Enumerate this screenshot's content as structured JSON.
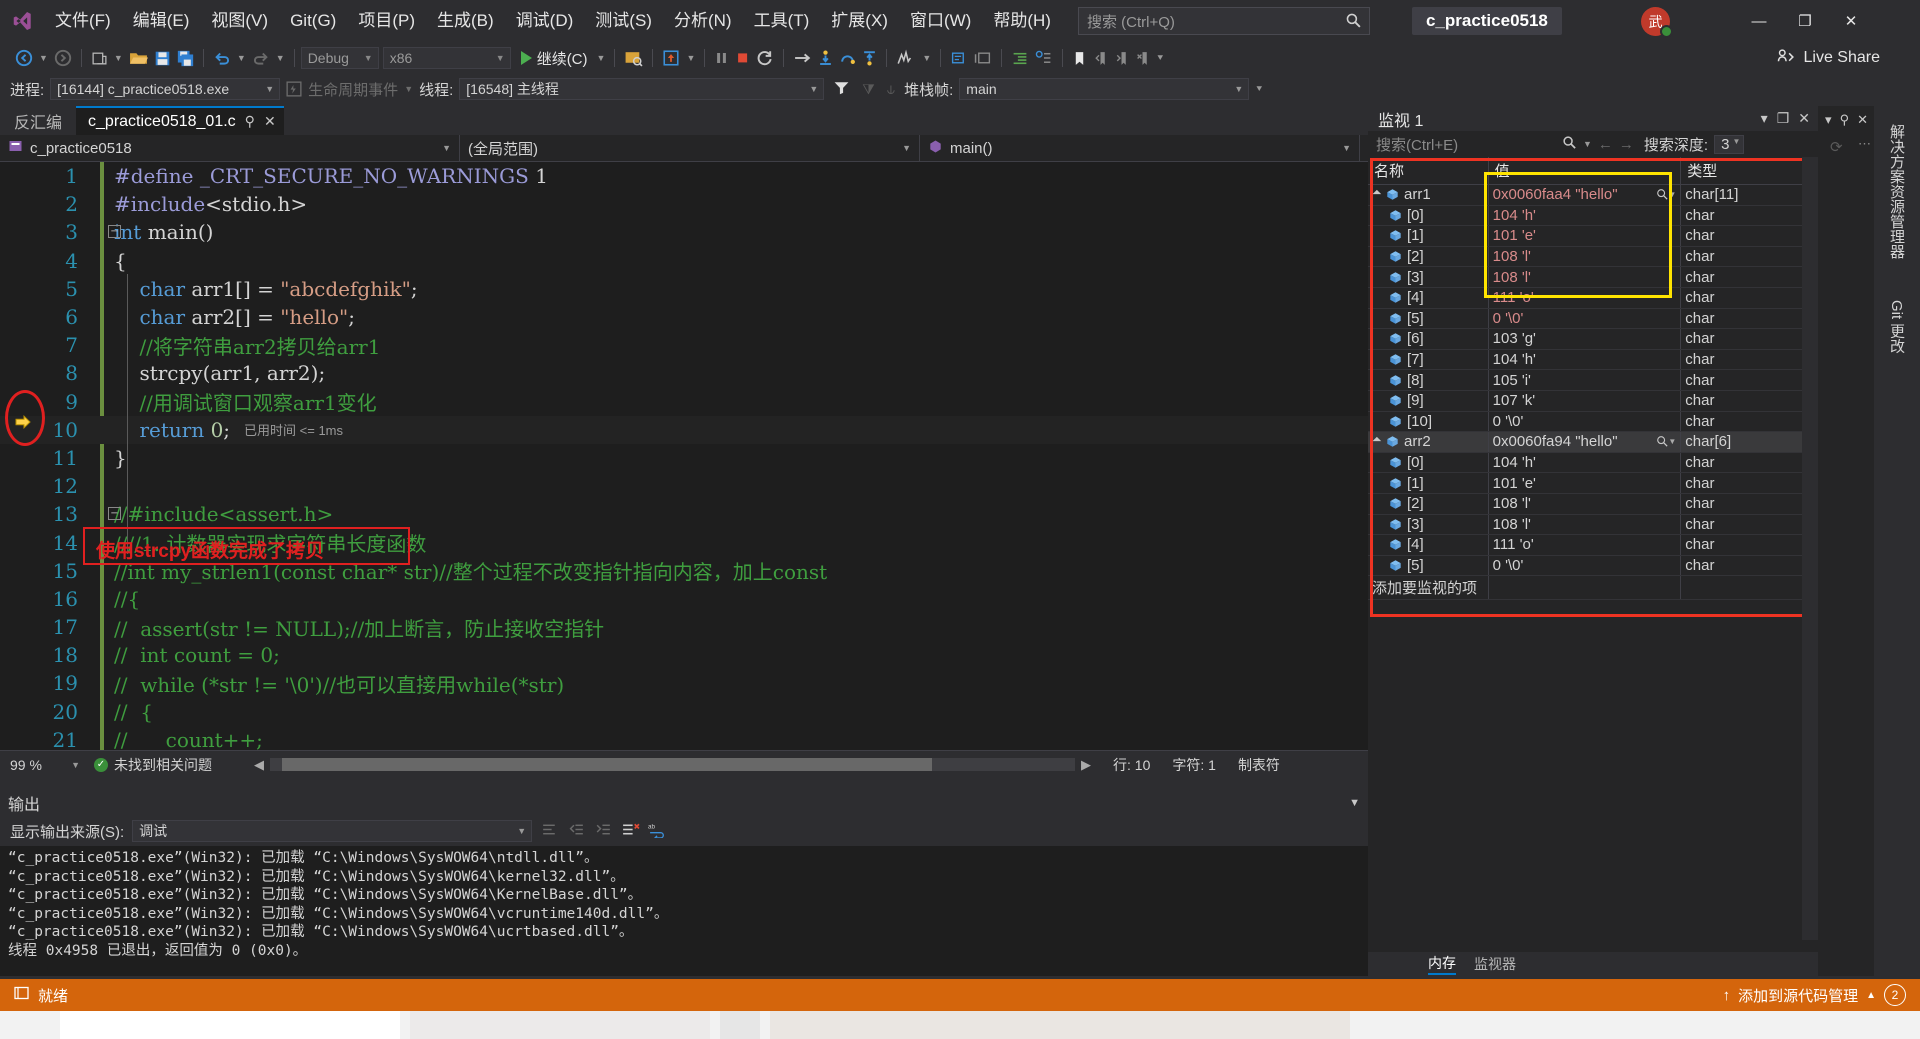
{
  "titlebar": {
    "logo_icon": "visual-studio-logo-icon",
    "menus": [
      "文件(F)",
      "编辑(E)",
      "视图(V)",
      "Git(G)",
      "项目(P)",
      "生成(B)",
      "调试(D)",
      "测试(S)",
      "分析(N)",
      "工具(T)",
      "扩展(X)",
      "窗口(W)",
      "帮助(H)"
    ],
    "search_placeholder": "搜索 (Ctrl+Q)",
    "search_icon": "search-icon",
    "project_chip": "c_practice0518",
    "avatar_initials": "武",
    "minimize": "—",
    "maximize": "❐",
    "close": "✕"
  },
  "toolbar": {
    "back_icon": "navigate-back-icon",
    "forward_icon": "navigate-forward-icon",
    "new_icon": "new-project-icon",
    "open_icon": "open-file-icon",
    "save_icon": "save-icon",
    "save_all_icon": "save-all-icon",
    "undo_icon": "undo-icon",
    "redo_icon": "redo-icon",
    "config": "Debug",
    "platform": "x86",
    "continue_label": "继续(C)",
    "continue_icon": "play-icon",
    "attach_icon": "attach-process-icon",
    "hot_reload_icon": "hot-reload-icon",
    "break_icon": "pause-icon",
    "stop_icon": "stop-icon",
    "restart_icon": "restart-icon",
    "show_next_icon": "show-next-statement-icon",
    "step_into_icon": "step-into-icon",
    "step_over_icon": "step-over-icon",
    "step_out_icon": "step-out-icon",
    "diag_icon": "diagnostics-icon",
    "comment_icon": "comment-icon",
    "uncomment_icon": "uncomment-icon",
    "indent_icon": "indent-icon",
    "outdent_icon": "outdent-icon",
    "bookmark_icon": "bookmark-icon",
    "prev_bookmark_icon": "previous-bookmark-icon",
    "next_bookmark_icon": "next-bookmark-icon",
    "clear_bookmark_icon": "clear-bookmark-icon",
    "live_share": "Live Share",
    "live_share_icon": "live-share-icon"
  },
  "debugbar": {
    "process_label": "进程:",
    "process_value": "[16144] c_practice0518.exe",
    "lifecycle_label": "生命周期事件",
    "lifecycle_icon": "lifecycle-events-icon",
    "thread_label": "线程:",
    "thread_value": "[16548] 主线程",
    "filter_icon": "filter-icon",
    "stack_label": "堆栈帧:",
    "stack_value": "main"
  },
  "editor": {
    "tab_disasm": "反汇编",
    "tab_file": "c_practice0518_01.c",
    "tab_pin_icon": "pin-icon",
    "tab_close_icon": "close-icon",
    "nav_project": "c_practice0518",
    "nav_project_icon": "project-icon",
    "nav_scope": "(全局范围)",
    "nav_member": "main()",
    "nav_member_icon": "method-icon",
    "lines": [
      {
        "n": "1",
        "html": "<span class='k-pp'>#define</span> <span class='k-pp'>_CRT_SECURE_NO_WARNINGS</span> <span class='k-pl'>1</span>",
        "indent": 0
      },
      {
        "n": "2",
        "html": "<span class='k-pp'>#include</span><span class='k-pl'>&lt;stdio.h&gt;</span>",
        "indent": 0
      },
      {
        "n": "3",
        "html": "<span class='k-kw'>int</span> <span class='k-pl'>main</span><span class='k-pl'>()</span>",
        "indent": 0,
        "collapse": true
      },
      {
        "n": "4",
        "html": "<span class='k-pl'>{</span>",
        "indent": 0
      },
      {
        "n": "5",
        "html": "    <span class='k-kw'>char</span> <span class='k-pl'>arr1[] = </span><span class='k-str'>\"abcdefghik\"</span><span class='k-pl'>;</span>",
        "indent": 0
      },
      {
        "n": "6",
        "html": "    <span class='k-kw'>char</span> <span class='k-pl'>arr2[] = </span><span class='k-str'>\"hello\"</span><span class='k-pl'>;</span>",
        "indent": 0
      },
      {
        "n": "7",
        "html": "    <span class='k-cmt'>//将字符串arr2拷贝给arr1</span>",
        "indent": 0
      },
      {
        "n": "8",
        "html": "    <span class='k-pl'>strcpy(arr1, arr2);</span>",
        "indent": 0
      },
      {
        "n": "9",
        "html": "    <span class='k-cmt'>//用调试窗口观察arr1变化</span>",
        "indent": 0
      },
      {
        "n": "10",
        "html": "    <span class='k-kw'>return</span> <span class='k-num'>0</span><span class='k-pl'>;</span>",
        "indent": 0,
        "elapsed": "已用时间 <= 1ms",
        "current": true
      },
      {
        "n": "11",
        "html": "<span class='k-pl'>}</span>",
        "indent": 0
      },
      {
        "n": "12",
        "html": "",
        "indent": 0
      },
      {
        "n": "13",
        "html": "<span class='k-cmt'>//#include&lt;assert.h&gt;</span>",
        "indent": 0,
        "collapse": true
      },
      {
        "n": "14",
        "html": "<span class='k-cmt'>////1. 计数器实现求字符串长度函数</span>",
        "indent": 0
      },
      {
        "n": "15",
        "html": "<span class='k-cmt'>//int my_strlen1(const char* str)//整个过程不改变指针指向内容，加上const</span>",
        "indent": 0
      },
      {
        "n": "16",
        "html": "<span class='k-cmt'>//{</span>",
        "indent": 0
      },
      {
        "n": "17",
        "html": "<span class='k-cmt'>//  assert(str != NULL);//加上断言，防止接收空指针</span>",
        "indent": 0
      },
      {
        "n": "18",
        "html": "<span class='k-cmt'>//  int count = 0;</span>",
        "indent": 0
      },
      {
        "n": "19",
        "html": "<span class='k-cmt'>//  while (*str != '\\0')//也可以直接用while(*str)</span>",
        "indent": 0
      },
      {
        "n": "20",
        "html": "<span class='k-cmt'>//  {</span>",
        "indent": 0
      },
      {
        "n": "21",
        "html": "<span class='k-cmt'>//      count++;</span>",
        "indent": 0
      }
    ],
    "annotation_text": "使用strcpy函数完成了拷贝",
    "ip_arrow_icon": "instruction-pointer-arrow-icon",
    "status": {
      "zoom": "99 %",
      "issues_icon": "no-issues-check-icon",
      "issues": "未找到相关问题",
      "line": "行: 10",
      "col": "字符: 1",
      "ins": "制表符"
    }
  },
  "output": {
    "title": "输出",
    "collapse_icon": "chevron-down-icon",
    "source_label": "显示输出来源(S):",
    "source_value": "调试",
    "clear_icon": "clear-all-icon",
    "toggle_wrap_icon": "toggle-word-wrap-icon",
    "go_prev_icon": "go-to-previous-icon",
    "go_next_icon": "go-to-next-icon",
    "lines": [
      "“c_practice0518.exe”(Win32): 已加载 “C:\\Windows\\SysWOW64\\ntdll.dll”。",
      "“c_practice0518.exe”(Win32): 已加载 “C:\\Windows\\SysWOW64\\kernel32.dll”。",
      "“c_practice0518.exe”(Win32): 已加载 “C:\\Windows\\SysWOW64\\KernelBase.dll”。",
      "“c_practice0518.exe”(Win32): 已加载 “C:\\Windows\\SysWOW64\\vcruntime140d.dll”。",
      "“c_practice0518.exe”(Win32): 已加载 “C:\\Windows\\SysWOW64\\ucrtbased.dll”。",
      "线程 0x4958 已退出，返回值为 0 (0x0)。"
    ]
  },
  "watch": {
    "title": "监视 1",
    "dropdown_icon": "chevron-down-icon",
    "float_icon": "float-window-icon",
    "close_icon": "close-icon",
    "search_placeholder": "搜索(Ctrl+E)",
    "search_icon": "search-icon",
    "prev_icon": "arrow-left-icon",
    "next_icon": "arrow-right-icon",
    "depth_label": "搜索深度:",
    "depth_value": "3",
    "columns": [
      "名称",
      "值",
      "类型"
    ],
    "rows": [
      {
        "name": "arr1",
        "value": "0x0060faa4 \"hello\"",
        "type": "char[11]",
        "depth": 0,
        "expanded": true,
        "changed": true,
        "magnifier": true
      },
      {
        "name": "[0]",
        "value": "104 'h'",
        "type": "char",
        "depth": 1,
        "changed": true
      },
      {
        "name": "[1]",
        "value": "101 'e'",
        "type": "char",
        "depth": 1,
        "changed": true
      },
      {
        "name": "[2]",
        "value": "108 'l'",
        "type": "char",
        "depth": 1,
        "changed": true
      },
      {
        "name": "[3]",
        "value": "108 'l'",
        "type": "char",
        "depth": 1,
        "changed": true
      },
      {
        "name": "[4]",
        "value": "111 'o'",
        "type": "char",
        "depth": 1,
        "changed": true
      },
      {
        "name": "[5]",
        "value": "0 '\\0'",
        "type": "char",
        "depth": 1,
        "changed": true
      },
      {
        "name": "[6]",
        "value": "103 'g'",
        "type": "char",
        "depth": 1,
        "changed": false
      },
      {
        "name": "[7]",
        "value": "104 'h'",
        "type": "char",
        "depth": 1,
        "changed": false
      },
      {
        "name": "[8]",
        "value": "105 'i'",
        "type": "char",
        "depth": 1,
        "changed": false
      },
      {
        "name": "[9]",
        "value": "107 'k'",
        "type": "char",
        "depth": 1,
        "changed": false
      },
      {
        "name": "[10]",
        "value": "0 '\\0'",
        "type": "char",
        "depth": 1,
        "changed": false
      },
      {
        "name": "arr2",
        "value": "0x0060fa94 \"hello\"",
        "type": "char[6]",
        "depth": 0,
        "expanded": true,
        "changed": false,
        "magnifier": true,
        "selected": true
      },
      {
        "name": "[0]",
        "value": "104 'h'",
        "type": "char",
        "depth": 1,
        "changed": false
      },
      {
        "name": "[1]",
        "value": "101 'e'",
        "type": "char",
        "depth": 1,
        "changed": false
      },
      {
        "name": "[2]",
        "value": "108 'l'",
        "type": "char",
        "depth": 1,
        "changed": false
      },
      {
        "name": "[3]",
        "value": "108 'l'",
        "type": "char",
        "depth": 1,
        "changed": false
      },
      {
        "name": "[4]",
        "value": "111 'o'",
        "type": "char",
        "depth": 1,
        "changed": false
      },
      {
        "name": "[5]",
        "value": "0 '\\0'",
        "type": "char",
        "depth": 1,
        "changed": false
      }
    ],
    "add_row": "添加要监视的项",
    "tabs": [
      "内存",
      "监视器"
    ],
    "active_tab": "内存"
  },
  "rightdock": {
    "pin_icon": "pin-icon",
    "close_icon": "close-icon",
    "refresh_icon": "refresh-icon",
    "more_icon": "more-options-icon",
    "vtabs": [
      "解决方案资源管理器",
      "Git 更改"
    ]
  },
  "statusbar": {
    "ready_icon": "ready-icon",
    "ready": "就绪",
    "source_control": "添加到源代码管理",
    "up_icon": "arrow-up-icon",
    "chevron_icon": "chevron-up-icon",
    "notify_count": "2",
    "notify_icon": "notifications-icon"
  },
  "colors": {
    "accent": "#007acc",
    "status_orange": "#d4650c",
    "annotation_red": "#e02020",
    "highlight_yellow": "#ffe400",
    "keyword_blue": "#569cd6",
    "comment_green": "#3f9e3f",
    "string_orange": "#d69d85",
    "changed_value": "#d98b8b"
  }
}
